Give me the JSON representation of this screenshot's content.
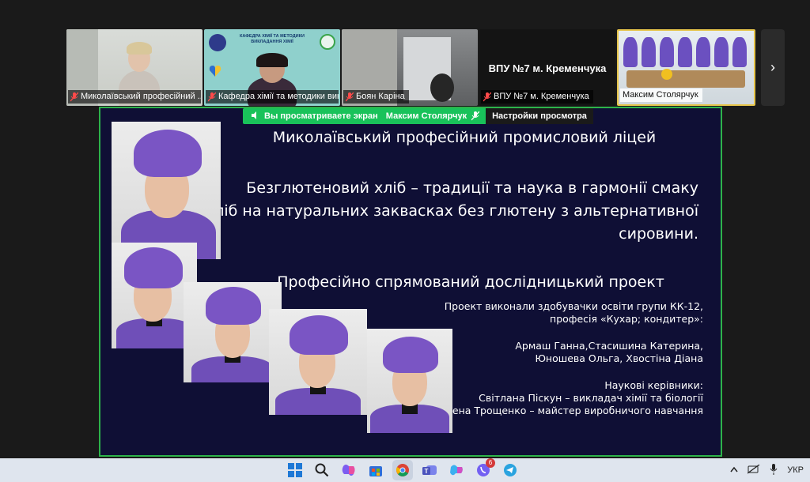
{
  "participants": [
    {
      "name": "Миколаївський професійний ...",
      "muted": true
    },
    {
      "name": "Кафедра хімії та методики вик...",
      "muted": true,
      "logo_text": "КАФЕДРА ХІМІЇ ТА МЕТОДИКИ ВИКЛАДАННЯ ХІМІЇ"
    },
    {
      "name": "Боян Каріна",
      "muted": true
    },
    {
      "name": "ВПУ №7 м. Кременчука",
      "muted": true,
      "big_name": "ВПУ №7 м. Кременчука"
    },
    {
      "name": "Максим Столярчук",
      "muted": false
    }
  ],
  "share_banner": {
    "viewing_text": "Вы просматриваете экран",
    "presenter": "Максим Столярчук",
    "settings": "Настройки просмотра"
  },
  "slide": {
    "line1": "Миколаївський професійний промисловий ліцей",
    "line2": "Безглютеновий хліб – традиції та наука в гармонії смаку",
    "line3": "Хліб на натуральних заквасках без глютену з альтернативної",
    "line4": "сировини.",
    "line5": "Професійно спрямований дослідницький проект",
    "info1": "Проект виконали здобувачки освіти групи КК-12,",
    "info2": "професія «Кухар; кондитер»:",
    "info3": "Армаш Ганна,Стасишина Катерина,",
    "info4": "Юношева Ольга,  Хвостіна Діана",
    "info5": "Наукові керівники:",
    "info6": "Світлана Піскун – викладач хімії та біології",
    "info7": "Олена Трощенко – майстер виробничого навчання"
  },
  "taskbar": {
    "teams_badge": "6",
    "language": "УКР"
  },
  "colors": {
    "share_green": "#19c25a",
    "slide_bg": "#0f0f35",
    "chef_purple": "#7a55c4",
    "active_border": "#e6c44a"
  }
}
